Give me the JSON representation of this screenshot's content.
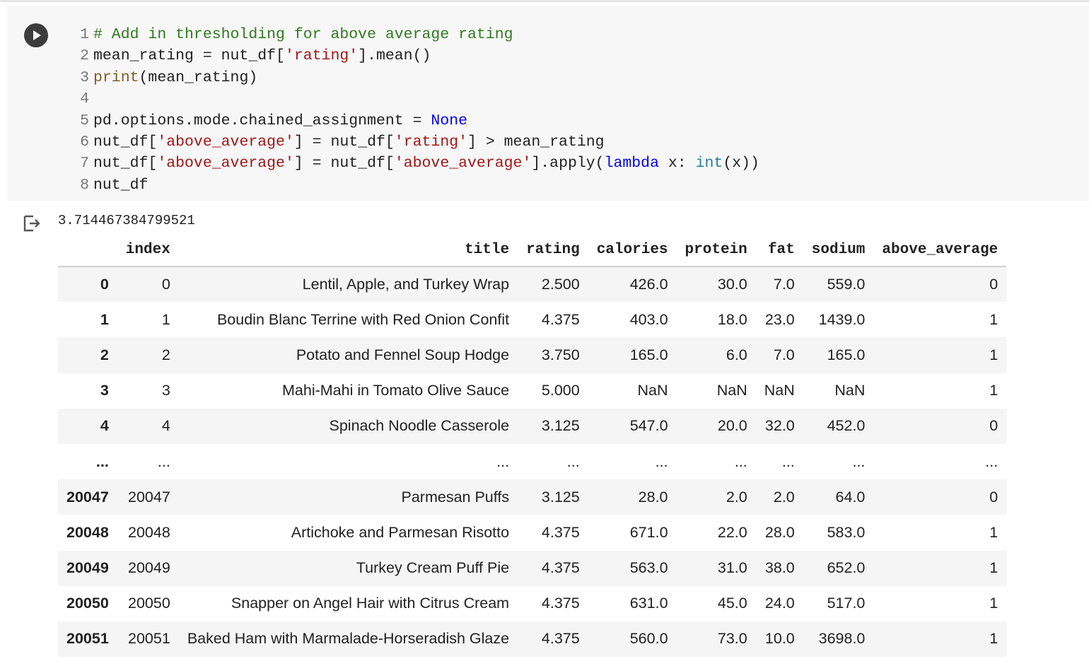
{
  "code": {
    "lines": [
      {
        "n": "1",
        "tokens": [
          {
            "t": "comment",
            "v": "# Add in thresholding for above average rating"
          }
        ]
      },
      {
        "n": "2",
        "tokens": [
          {
            "t": "plain",
            "v": "mean_rating = nut_df["
          },
          {
            "t": "str",
            "v": "'rating'"
          },
          {
            "t": "plain",
            "v": "].mean()"
          }
        ]
      },
      {
        "n": "3",
        "tokens": [
          {
            "t": "builtin",
            "v": "print"
          },
          {
            "t": "plain",
            "v": "(mean_rating)"
          }
        ]
      },
      {
        "n": "4",
        "tokens": []
      },
      {
        "n": "5",
        "tokens": [
          {
            "t": "plain",
            "v": "pd.options.mode.chained_assignment = "
          },
          {
            "t": "kw",
            "v": "None"
          }
        ]
      },
      {
        "n": "6",
        "tokens": [
          {
            "t": "plain",
            "v": "nut_df["
          },
          {
            "t": "str",
            "v": "'above_average'"
          },
          {
            "t": "plain",
            "v": "] = nut_df["
          },
          {
            "t": "str",
            "v": "'rating'"
          },
          {
            "t": "plain",
            "v": "] > mean_rating"
          }
        ]
      },
      {
        "n": "7",
        "tokens": [
          {
            "t": "plain",
            "v": "nut_df["
          },
          {
            "t": "str",
            "v": "'above_average'"
          },
          {
            "t": "plain",
            "v": "] = nut_df["
          },
          {
            "t": "str",
            "v": "'above_average'"
          },
          {
            "t": "plain",
            "v": "].apply("
          },
          {
            "t": "kw",
            "v": "lambda"
          },
          {
            "t": "plain",
            "v": " x: "
          },
          {
            "t": "type",
            "v": "int"
          },
          {
            "t": "plain",
            "v": "(x))"
          }
        ]
      },
      {
        "n": "8",
        "tokens": [
          {
            "t": "plain",
            "v": "nut_df"
          }
        ]
      }
    ]
  },
  "output": {
    "stdout": "3.714467384799521",
    "columns": [
      "",
      "index",
      "title",
      "rating",
      "calories",
      "protein",
      "fat",
      "sodium",
      "above_average"
    ],
    "rows": [
      [
        "0",
        "0",
        "Lentil, Apple, and Turkey Wrap",
        "2.500",
        "426.0",
        "30.0",
        "7.0",
        "559.0",
        "0"
      ],
      [
        "1",
        "1",
        "Boudin Blanc Terrine with Red Onion Confit",
        "4.375",
        "403.0",
        "18.0",
        "23.0",
        "1439.0",
        "1"
      ],
      [
        "2",
        "2",
        "Potato and Fennel Soup Hodge",
        "3.750",
        "165.0",
        "6.0",
        "7.0",
        "165.0",
        "1"
      ],
      [
        "3",
        "3",
        "Mahi-Mahi in Tomato Olive Sauce",
        "5.000",
        "NaN",
        "NaN",
        "NaN",
        "NaN",
        "1"
      ],
      [
        "4",
        "4",
        "Spinach Noodle Casserole",
        "3.125",
        "547.0",
        "20.0",
        "32.0",
        "452.0",
        "0"
      ],
      [
        "...",
        "...",
        "...",
        "...",
        "...",
        "...",
        "...",
        "...",
        "..."
      ],
      [
        "20047",
        "20047",
        "Parmesan Puffs",
        "3.125",
        "28.0",
        "2.0",
        "2.0",
        "64.0",
        "0"
      ],
      [
        "20048",
        "20048",
        "Artichoke and Parmesan Risotto",
        "4.375",
        "671.0",
        "22.0",
        "28.0",
        "583.0",
        "1"
      ],
      [
        "20049",
        "20049",
        "Turkey Cream Puff Pie",
        "4.375",
        "563.0",
        "31.0",
        "38.0",
        "652.0",
        "1"
      ],
      [
        "20050",
        "20050",
        "Snapper on Angel Hair with Citrus Cream",
        "4.375",
        "631.0",
        "45.0",
        "24.0",
        "517.0",
        "1"
      ],
      [
        "20051",
        "20051",
        "Baked Ham with Marmalade-Horseradish Glaze",
        "4.375",
        "560.0",
        "73.0",
        "10.0",
        "3698.0",
        "1"
      ]
    ]
  },
  "icons": {
    "run": "play-circle-icon",
    "output": "output-arrow-icon"
  },
  "colors": {
    "comment": "#2f7a1f",
    "string": "#a31515",
    "keyword": "#0000ff",
    "builtin": "#795e26",
    "type": "#267f99",
    "cell_background": "#f7f7f7",
    "row_stripe": "#f5f5f5"
  }
}
